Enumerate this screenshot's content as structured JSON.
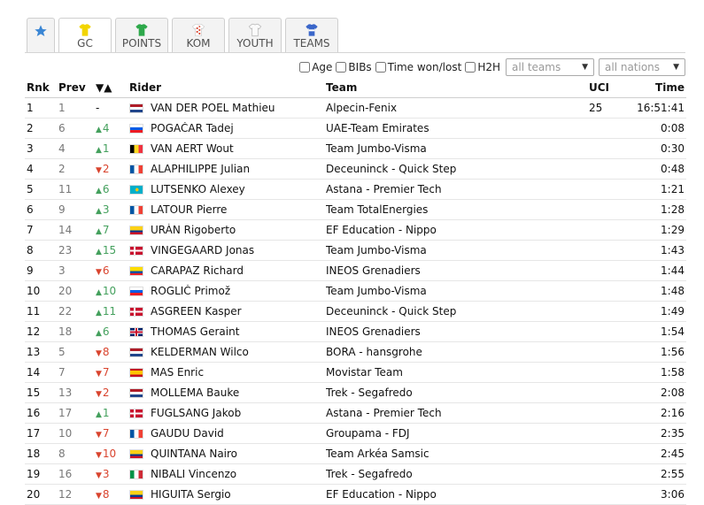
{
  "tabs": [
    {
      "key": "star",
      "label": "",
      "icon": "star-icon",
      "color": "#3a86d4"
    },
    {
      "key": "gc",
      "label": "GC",
      "icon": "jersey-yellow-icon",
      "color": "#f2d500"
    },
    {
      "key": "points",
      "label": "POINTS",
      "icon": "jersey-green-icon",
      "color": "#2da84a"
    },
    {
      "key": "kom",
      "label": "KOM",
      "icon": "jersey-polka-icon",
      "color": "#d9442e"
    },
    {
      "key": "youth",
      "label": "YOUTH",
      "icon": "jersey-white-icon",
      "color": "#e0e0e0"
    },
    {
      "key": "teams",
      "label": "TEAMS",
      "icon": "jersey-teams-icon",
      "color": "#3a66c9"
    }
  ],
  "filters": {
    "age": "Age",
    "bibs": "BIBs",
    "time_won_lost": "Time won/lost",
    "h2h": "H2H",
    "teams_select": "all teams",
    "nations_select": "all nations"
  },
  "headers": {
    "rnk": "Rnk",
    "prev": "Prev",
    "diff": "▼▲",
    "rider": "Rider",
    "team": "Team",
    "uci": "UCI",
    "time": "Time"
  },
  "rows": [
    {
      "rnk": "1",
      "prev": "1",
      "dir": "none",
      "diff": "-",
      "rider": "VAN DER POEL Mathieu",
      "flag": "nl",
      "team": "Alpecin-Fenix",
      "uci": "25",
      "time": "16:51:41"
    },
    {
      "rnk": "2",
      "prev": "6",
      "dir": "up",
      "diff": "4",
      "rider": "POGAČAR Tadej",
      "flag": "si",
      "team": "UAE-Team Emirates",
      "uci": "",
      "time": "0:08"
    },
    {
      "rnk": "3",
      "prev": "4",
      "dir": "up",
      "diff": "1",
      "rider": "VAN AERT Wout",
      "flag": "be",
      "team": "Team Jumbo-Visma",
      "uci": "",
      "time": "0:30"
    },
    {
      "rnk": "4",
      "prev": "2",
      "dir": "down",
      "diff": "2",
      "rider": "ALAPHILIPPE Julian",
      "flag": "fr",
      "team": "Deceuninck - Quick Step",
      "uci": "",
      "time": "0:48"
    },
    {
      "rnk": "5",
      "prev": "11",
      "dir": "up",
      "diff": "6",
      "rider": "LUTSENKO Alexey",
      "flag": "kz",
      "team": "Astana - Premier Tech",
      "uci": "",
      "time": "1:21"
    },
    {
      "rnk": "6",
      "prev": "9",
      "dir": "up",
      "diff": "3",
      "rider": "LATOUR Pierre",
      "flag": "fr",
      "team": "Team TotalEnergies",
      "uci": "",
      "time": "1:28"
    },
    {
      "rnk": "7",
      "prev": "14",
      "dir": "up",
      "diff": "7",
      "rider": "URÁN Rigoberto",
      "flag": "co",
      "team": "EF Education - Nippo",
      "uci": "",
      "time": "1:29"
    },
    {
      "rnk": "8",
      "prev": "23",
      "dir": "up",
      "diff": "15",
      "rider": "VINGEGAARD Jonas",
      "flag": "dk",
      "team": "Team Jumbo-Visma",
      "uci": "",
      "time": "1:43"
    },
    {
      "rnk": "9",
      "prev": "3",
      "dir": "down",
      "diff": "6",
      "rider": "CARAPAZ Richard",
      "flag": "ec",
      "team": "INEOS Grenadiers",
      "uci": "",
      "time": "1:44"
    },
    {
      "rnk": "10",
      "prev": "20",
      "dir": "up",
      "diff": "10",
      "rider": "ROGLIČ Primož",
      "flag": "si",
      "team": "Team Jumbo-Visma",
      "uci": "",
      "time": "1:48"
    },
    {
      "rnk": "11",
      "prev": "22",
      "dir": "up",
      "diff": "11",
      "rider": "ASGREEN Kasper",
      "flag": "dk",
      "team": "Deceuninck - Quick Step",
      "uci": "",
      "time": "1:49"
    },
    {
      "rnk": "12",
      "prev": "18",
      "dir": "up",
      "diff": "6",
      "rider": "THOMAS Geraint",
      "flag": "gb",
      "team": "INEOS Grenadiers",
      "uci": "",
      "time": "1:54"
    },
    {
      "rnk": "13",
      "prev": "5",
      "dir": "down",
      "diff": "8",
      "rider": "KELDERMAN Wilco",
      "flag": "nl",
      "team": "BORA - hansgrohe",
      "uci": "",
      "time": "1:56"
    },
    {
      "rnk": "14",
      "prev": "7",
      "dir": "down",
      "diff": "7",
      "rider": "MAS Enric",
      "flag": "es",
      "team": "Movistar Team",
      "uci": "",
      "time": "1:58"
    },
    {
      "rnk": "15",
      "prev": "13",
      "dir": "down",
      "diff": "2",
      "rider": "MOLLEMA Bauke",
      "flag": "nl",
      "team": "Trek - Segafredo",
      "uci": "",
      "time": "2:08"
    },
    {
      "rnk": "16",
      "prev": "17",
      "dir": "up",
      "diff": "1",
      "rider": "FUGLSANG Jakob",
      "flag": "dk",
      "team": "Astana - Premier Tech",
      "uci": "",
      "time": "2:16"
    },
    {
      "rnk": "17",
      "prev": "10",
      "dir": "down",
      "diff": "7",
      "rider": "GAUDU David",
      "flag": "fr",
      "team": "Groupama - FDJ",
      "uci": "",
      "time": "2:35"
    },
    {
      "rnk": "18",
      "prev": "8",
      "dir": "down",
      "diff": "10",
      "rider": "QUINTANA Nairo",
      "flag": "co",
      "team": "Team Arkéa Samsic",
      "uci": "",
      "time": "2:45"
    },
    {
      "rnk": "19",
      "prev": "16",
      "dir": "down",
      "diff": "3",
      "rider": "NIBALI Vincenzo",
      "flag": "it",
      "team": "Trek - Segafredo",
      "uci": "",
      "time": "2:55"
    },
    {
      "rnk": "20",
      "prev": "12",
      "dir": "down",
      "diff": "8",
      "rider": "HIGUITA Sergio",
      "flag": "co",
      "team": "EF Education - Nippo",
      "uci": "",
      "time": "3:06"
    }
  ]
}
